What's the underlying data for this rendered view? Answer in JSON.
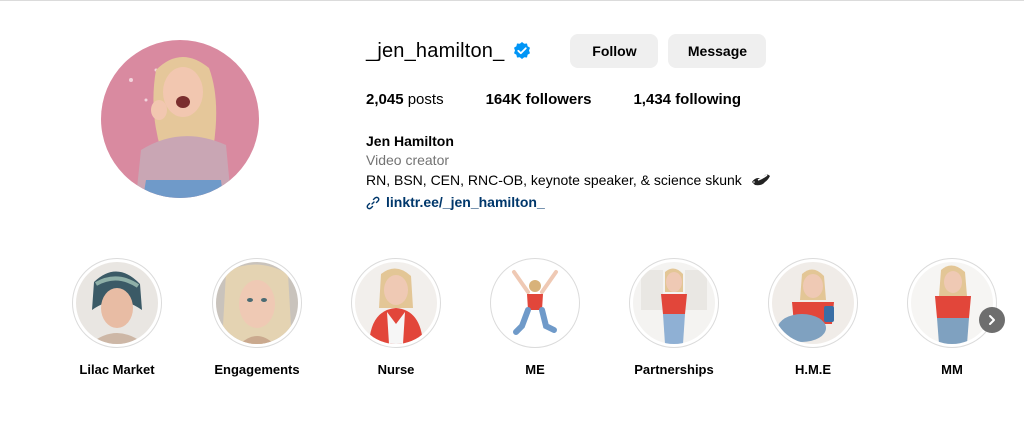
{
  "profile": {
    "username": "_jen_hamilton_",
    "verified": true,
    "follow_label": "Follow",
    "message_label": "Message",
    "stats": {
      "posts_count": "2,045",
      "posts_label": "posts",
      "followers_count": "164K",
      "followers_label": "followers",
      "following_count": "1,434",
      "following_label": "following"
    },
    "bio": {
      "full_name": "Jen Hamilton",
      "category": "Video creator",
      "description": "RN, BSN, CEN, RNC-OB, keynote speaker, & science skunk",
      "link": "linktr.ee/_jen_hamilton_"
    }
  },
  "highlights": [
    {
      "label": "Lilac Market"
    },
    {
      "label": "Engagements"
    },
    {
      "label": "Nurse"
    },
    {
      "label": "ME"
    },
    {
      "label": "Partnerships"
    },
    {
      "label": "H.M.E"
    },
    {
      "label": "MM"
    }
  ],
  "colors": {
    "verified_blue": "#0095f6",
    "link_blue": "#00376b",
    "button_gray": "#efefef",
    "muted_text": "#737373",
    "avatar_bg": "#d98aa0"
  },
  "icons": {
    "verified": "verified-badge-icon",
    "link": "link-icon",
    "emoji": "skunk-emoji-icon",
    "next": "chevron-right-icon"
  }
}
